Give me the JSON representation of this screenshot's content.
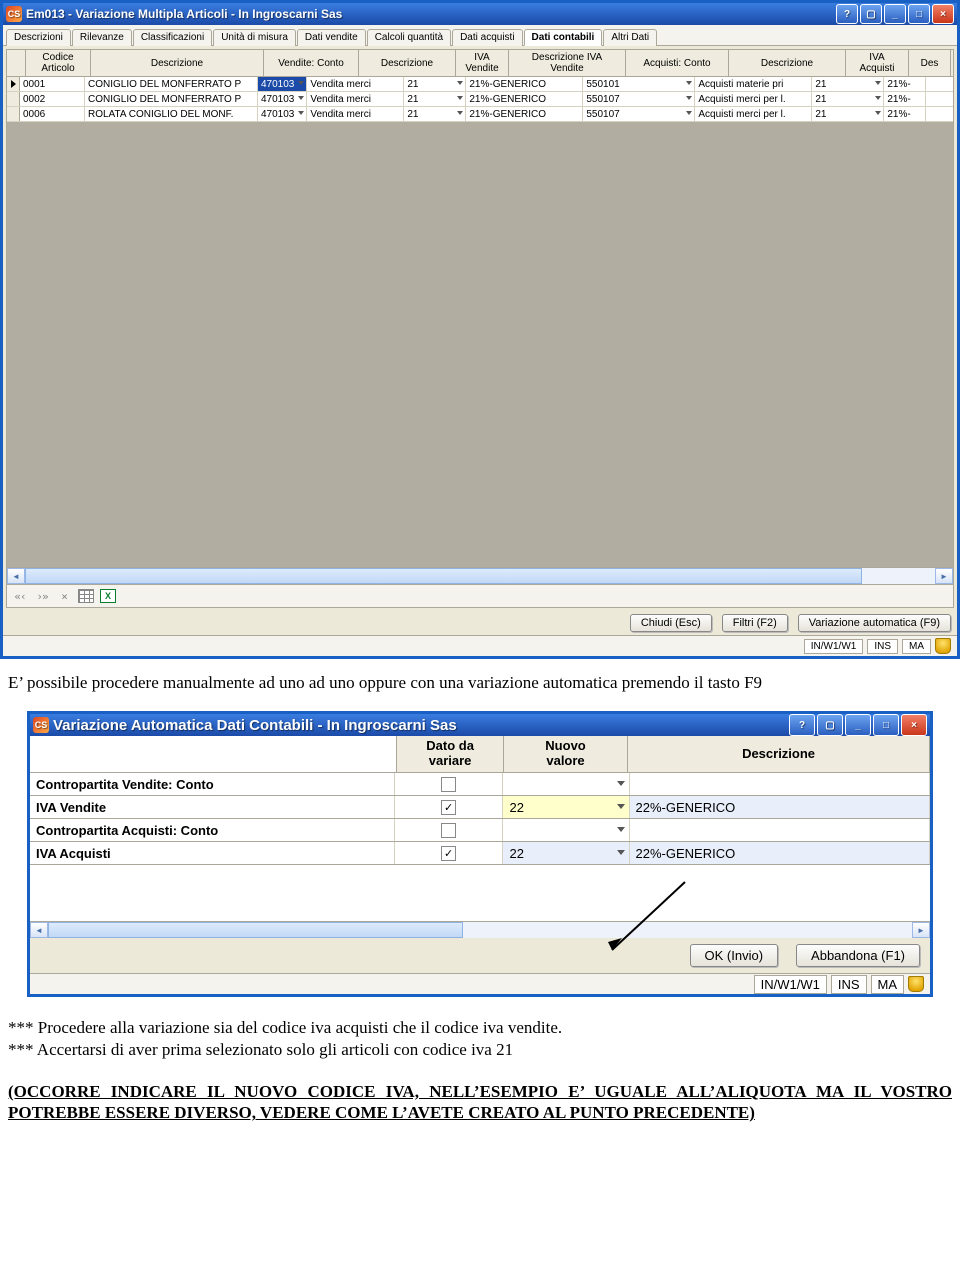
{
  "win1": {
    "icon_text": "CS",
    "title": "Em013 - Variazione Multipla Articoli - In Ingroscarni Sas",
    "winbtns": [
      "?",
      "▢",
      "_",
      "□",
      "×"
    ],
    "tabs": [
      "Descrizioni",
      "Rilevanze",
      "Classificazioni",
      "Unità di misura",
      "Dati vendite",
      "Calcoli quantità",
      "Dati acquisti",
      "Dati contabili",
      "Altri Dati"
    ],
    "active_tab": 7,
    "headers": [
      "Codice\nArticolo",
      "Descrizione",
      "Vendite: Conto",
      "Descrizione",
      "IVA\nVendite",
      "Descrizione IVA\nVendite",
      "Acquisti: Conto",
      "Descrizione",
      "IVA\nAcquisti",
      "Des"
    ],
    "rows": [
      {
        "cur": true,
        "codice": "0001",
        "desc": "CONIGLIO DEL MONFERRATO P",
        "vconto": "470103",
        "vsel": true,
        "vdesc": "Vendita merci",
        "iva": "21",
        "ivad": "21%-GENERICO",
        "aconto": "550101",
        "adesc": "Acquisti materie pri",
        "aiva": "21",
        "aivad": "21%-"
      },
      {
        "cur": false,
        "codice": "0002",
        "desc": "CONIGLIO DEL MONFERRATO P",
        "vconto": "470103",
        "vsel": false,
        "vdesc": "Vendita merci",
        "iva": "21",
        "ivad": "21%-GENERICO",
        "aconto": "550107",
        "adesc": "Acquisti merci per l.",
        "aiva": "21",
        "aivad": "21%-"
      },
      {
        "cur": false,
        "codice": "0006",
        "desc": "ROLATA CONIGLIO DEL MONF.",
        "vconto": "470103",
        "vsel": false,
        "vdesc": "Vendita merci",
        "iva": "21",
        "ivad": "21%-GENERICO",
        "aconto": "550107",
        "adesc": "Acquisti merci per l.",
        "aiva": "21",
        "aivad": "21%-"
      }
    ],
    "btn_close": "Chiudi (Esc)",
    "btn_filter": "Filtri (F2)",
    "btn_auto": "Variazione automatica (F9)",
    "status_path": "IN/W1/W1",
    "status_ins": "INS",
    "status_ma": "MA"
  },
  "para1": "E’ possibile procedere manualmente ad uno ad uno oppure con una variazione automatica premendo il tasto F9",
  "win2": {
    "icon_text": "CS",
    "title": "Variazione Automatica Dati Contabili - In Ingroscarni Sas",
    "winbtns": [
      "?",
      "▢",
      "_",
      "□",
      "×"
    ],
    "headers": [
      "Dato da\nvariare",
      "Nuovo\nvalore",
      "Descrizione"
    ],
    "rows": [
      {
        "label": "Contropartita Vendite: Conto",
        "ck": false,
        "val": "",
        "desc": "",
        "alt": false,
        "hl": false
      },
      {
        "label": "IVA Vendite",
        "ck": true,
        "val": "22",
        "desc": "22%-GENERICO",
        "alt": true,
        "hl": true
      },
      {
        "label": "Contropartita Acquisti: Conto",
        "ck": false,
        "val": "",
        "desc": "",
        "alt": false,
        "hl": false
      },
      {
        "label": "IVA Acquisti",
        "ck": true,
        "val": "22",
        "desc": "22%-GENERICO",
        "alt": true,
        "hl": false
      }
    ],
    "btn_ok": "OK (Invio)",
    "btn_cancel": "Abbandona (F1)",
    "status_path": "IN/W1/W1",
    "status_ins": "INS",
    "status_ma": "MA"
  },
  "notes": {
    "line1": "*** Procedere alla variazione sia del codice iva acquisti che il codice iva vendite.",
    "line2": "*** Accertarsi di aver prima selezionato solo gli articoli con codice iva 21",
    "bold": "(OCCORRE INDICARE IL NUOVO CODICE IVA, NELL’ESEMPIO E’ UGUALE ALL’ALIQUOTA MA IL VOSTRO POTREBBE ESSERE DIVERSO, VEDERE COME L’AVETE CREATO AL PUNTO PRECEDENTE)"
  }
}
